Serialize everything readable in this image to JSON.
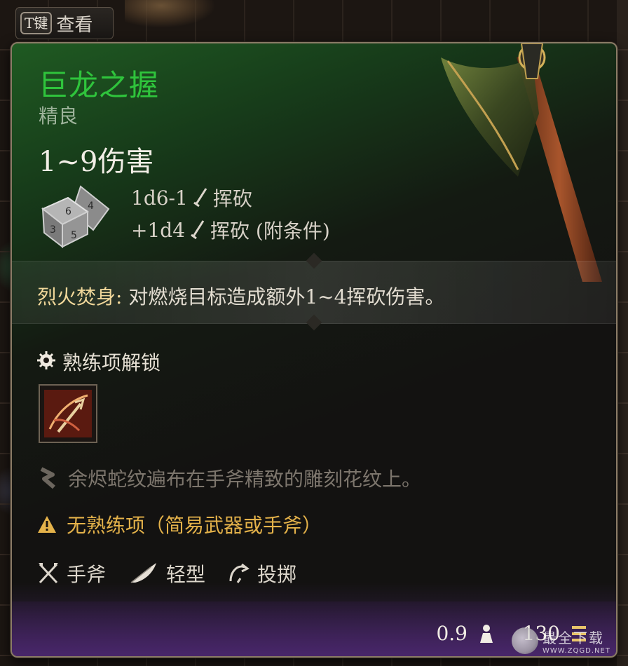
{
  "top_hint": {
    "key": "T键",
    "label": "查看"
  },
  "item": {
    "name": "巨龙之握",
    "rarity": "精良",
    "damage_total": "1~9伤害",
    "damage_lines": [
      {
        "dice": "1d6-1",
        "type": "挥砍"
      },
      {
        "dice": "+1d4",
        "type": "挥砍 (附条件)"
      }
    ]
  },
  "passive": {
    "name": "烈火焚身:",
    "text": " 对燃烧目标造成额外1~4挥砍伤害。"
  },
  "proficiency": {
    "title": "熟练项解锁"
  },
  "lore": "余烬蛇纹遍布在手斧精致的雕刻花纹上。",
  "warning": "无熟练项（简易武器或手斧）",
  "properties": [
    {
      "label": "手斧",
      "icon": "crossed-axes-icon"
    },
    {
      "label": "轻型",
      "icon": "feather-icon"
    },
    {
      "label": "投掷",
      "icon": "throw-icon"
    }
  ],
  "footer": {
    "weight": "0.9",
    "value": "130"
  },
  "watermark": {
    "text": "最全下载",
    "url": "WWW.ZQGD.NET"
  },
  "colors": {
    "name_green": "#2fc43c",
    "rarity": "#9fb49c",
    "passive_name": "#f0d79a",
    "warning": "#e4b24a",
    "lore": "#7d766d"
  }
}
